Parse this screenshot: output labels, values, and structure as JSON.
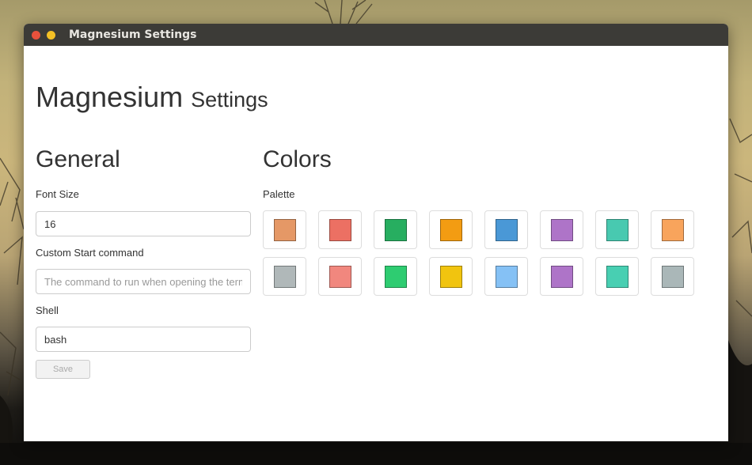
{
  "window": {
    "title": "Magnesium Settings"
  },
  "header": {
    "title": "Magnesium",
    "subtitle": "Settings"
  },
  "general": {
    "heading": "General",
    "font_size": {
      "label": "Font Size",
      "value": "16"
    },
    "start_command": {
      "label": "Custom Start command",
      "value": "",
      "placeholder": "The command to run when opening the terminal"
    },
    "shell": {
      "label": "Shell",
      "value": "bash"
    },
    "save_label": "Save"
  },
  "colors": {
    "heading": "Colors",
    "palette_label": "Palette",
    "palette": [
      "#e59866",
      "#ec7063",
      "#27ae60",
      "#f39c12",
      "#4a98d6",
      "#ae74c8",
      "#48c9b0",
      "#f8a45c",
      "#b0b8b9",
      "#f1877e",
      "#2ecc71",
      "#f1c40f",
      "#85c1f5",
      "#ae74c8",
      "#48cfb2",
      "#aab7b8"
    ]
  }
}
